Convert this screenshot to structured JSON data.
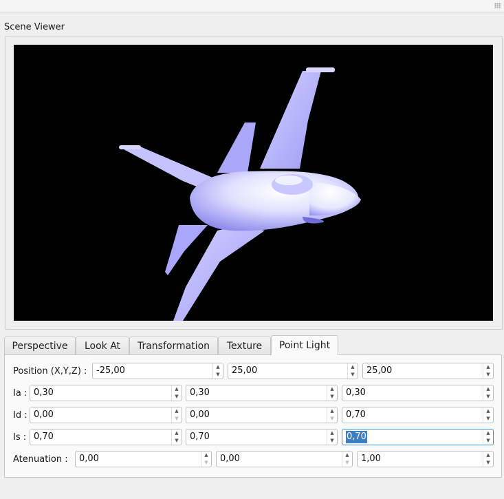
{
  "window": {
    "group_title": "Scene Viewer"
  },
  "tabs": [
    {
      "label": "Perspective"
    },
    {
      "label": "Look At"
    },
    {
      "label": "Transformation"
    },
    {
      "label": "Texture"
    },
    {
      "label": "Point Light",
      "active": true
    }
  ],
  "point_light": {
    "position": {
      "label": "Position (X,Y,Z) :",
      "values": [
        "-25,00",
        "25,00",
        "25,00"
      ]
    },
    "ia": {
      "label": "Ia :",
      "values": [
        "0,30",
        "0,30",
        "0,30"
      ]
    },
    "id": {
      "label": "Id :",
      "values": [
        "0,00",
        "0,00",
        "0,70"
      ]
    },
    "is": {
      "label": "Is :",
      "values": [
        "0,70",
        "0,70",
        "0,70"
      ]
    },
    "atenuation": {
      "label": "Atenuation :",
      "values": [
        "0,00",
        "0,00",
        "1,00"
      ]
    }
  },
  "colors": {
    "viewport_bg": "#000000",
    "model_color": "#b3b0ff",
    "selection": "#3b7fc4"
  },
  "icons": {
    "spin_up": "triangle-up-icon",
    "spin_down": "triangle-down-icon"
  }
}
